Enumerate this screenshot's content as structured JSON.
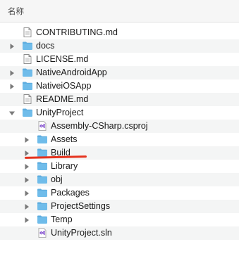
{
  "header": {
    "column_name": "名称"
  },
  "files": [
    {
      "name": "CONTRIBUTING.md",
      "kind": "file-icon",
      "expandable": false
    },
    {
      "name": "docs",
      "kind": "folder-icon",
      "expandable": true,
      "expanded": false
    },
    {
      "name": "LICENSE.md",
      "kind": "file-icon",
      "expandable": false
    },
    {
      "name": "NativeAndroidApp",
      "kind": "folder-icon",
      "expandable": true,
      "expanded": false
    },
    {
      "name": "NativeiOSApp",
      "kind": "folder-icon",
      "expandable": true,
      "expanded": false
    },
    {
      "name": "README.md",
      "kind": "file-icon",
      "expandable": false
    },
    {
      "name": "UnityProject",
      "kind": "folder-icon",
      "expandable": true,
      "expanded": true
    },
    {
      "name": "Assembly-CSharp.csproj",
      "kind": "visual-studio-icon",
      "expandable": false
    },
    {
      "name": "Assets",
      "kind": "folder-icon",
      "expandable": true,
      "expanded": false
    },
    {
      "name": "Build",
      "kind": "folder-icon",
      "expandable": true,
      "expanded": false
    },
    {
      "name": "Library",
      "kind": "folder-icon",
      "expandable": true,
      "expanded": false
    },
    {
      "name": "obj",
      "kind": "folder-icon",
      "expandable": true,
      "expanded": false
    },
    {
      "name": "Packages",
      "kind": "folder-icon",
      "expandable": true,
      "expanded": false
    },
    {
      "name": "ProjectSettings",
      "kind": "folder-icon",
      "expandable": true,
      "expanded": false
    },
    {
      "name": "Temp",
      "kind": "folder-icon",
      "expandable": true,
      "expanded": false
    },
    {
      "name": "UnityProject.sln",
      "kind": "visual-studio-icon",
      "expandable": false
    }
  ],
  "colors": {
    "folder": "#6fbcea",
    "folder_tab": "#5eaddf",
    "visual_studio": "#8a5bd1",
    "annotation": "#e5331e",
    "stripe": "#f4f5f5"
  }
}
